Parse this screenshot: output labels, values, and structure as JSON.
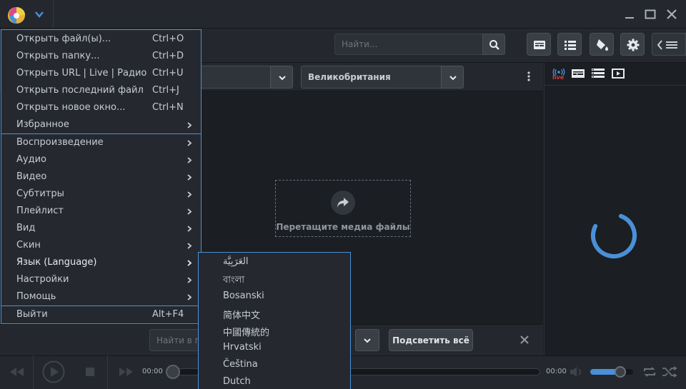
{
  "colors": {
    "accent": "#4a90d9",
    "live": "#e03b3b",
    "bg": "#1b1e22",
    "panel": "#24282e"
  },
  "toolbar": {
    "search_placeholder": "Найти..."
  },
  "filter": {
    "country": "Великобритания"
  },
  "drop_zone": {
    "text": "Перетащите медиа файлы"
  },
  "right_panel": {
    "live_label": "live"
  },
  "findbar": {
    "placeholder": "Найти в п",
    "highlight_label": "Подсветить всё"
  },
  "player": {
    "time_current": "00:00",
    "time_total": "00:00"
  },
  "menu": {
    "items": [
      {
        "label": "Открыть файл(ы)...",
        "shortcut": "Ctrl+O"
      },
      {
        "label": "Открыть папку...",
        "shortcut": "Ctrl+D"
      },
      {
        "label": "Открыть URL | Live | Радио...",
        "shortcut": "Ctrl+U"
      },
      {
        "label": "Открыть последний файл",
        "shortcut": "Ctrl+J"
      },
      {
        "label": "Открыть новое окно...",
        "shortcut": "Ctrl+N"
      },
      {
        "label": "Избранное",
        "shortcut": ""
      },
      {
        "label": "Воспроизведение",
        "shortcut": ""
      },
      {
        "label": "Аудио",
        "shortcut": ""
      },
      {
        "label": "Видео",
        "shortcut": ""
      },
      {
        "label": "Субтитры",
        "shortcut": ""
      },
      {
        "label": "Плейлист",
        "shortcut": ""
      },
      {
        "label": "Вид",
        "shortcut": ""
      },
      {
        "label": "Скин",
        "shortcut": ""
      },
      {
        "label": "Язык (Language)",
        "shortcut": ""
      },
      {
        "label": "Настройки",
        "shortcut": ""
      },
      {
        "label": "Помощь",
        "shortcut": ""
      },
      {
        "label": "Выйти",
        "shortcut": "Alt+F4"
      }
    ]
  },
  "language_submenu": {
    "items": [
      "العَرَبِيَّة",
      "বাংলা",
      "Bosanski",
      "简体中文",
      "中國傳統的",
      "Hrvatski",
      "Čeština",
      "Dutch"
    ]
  }
}
